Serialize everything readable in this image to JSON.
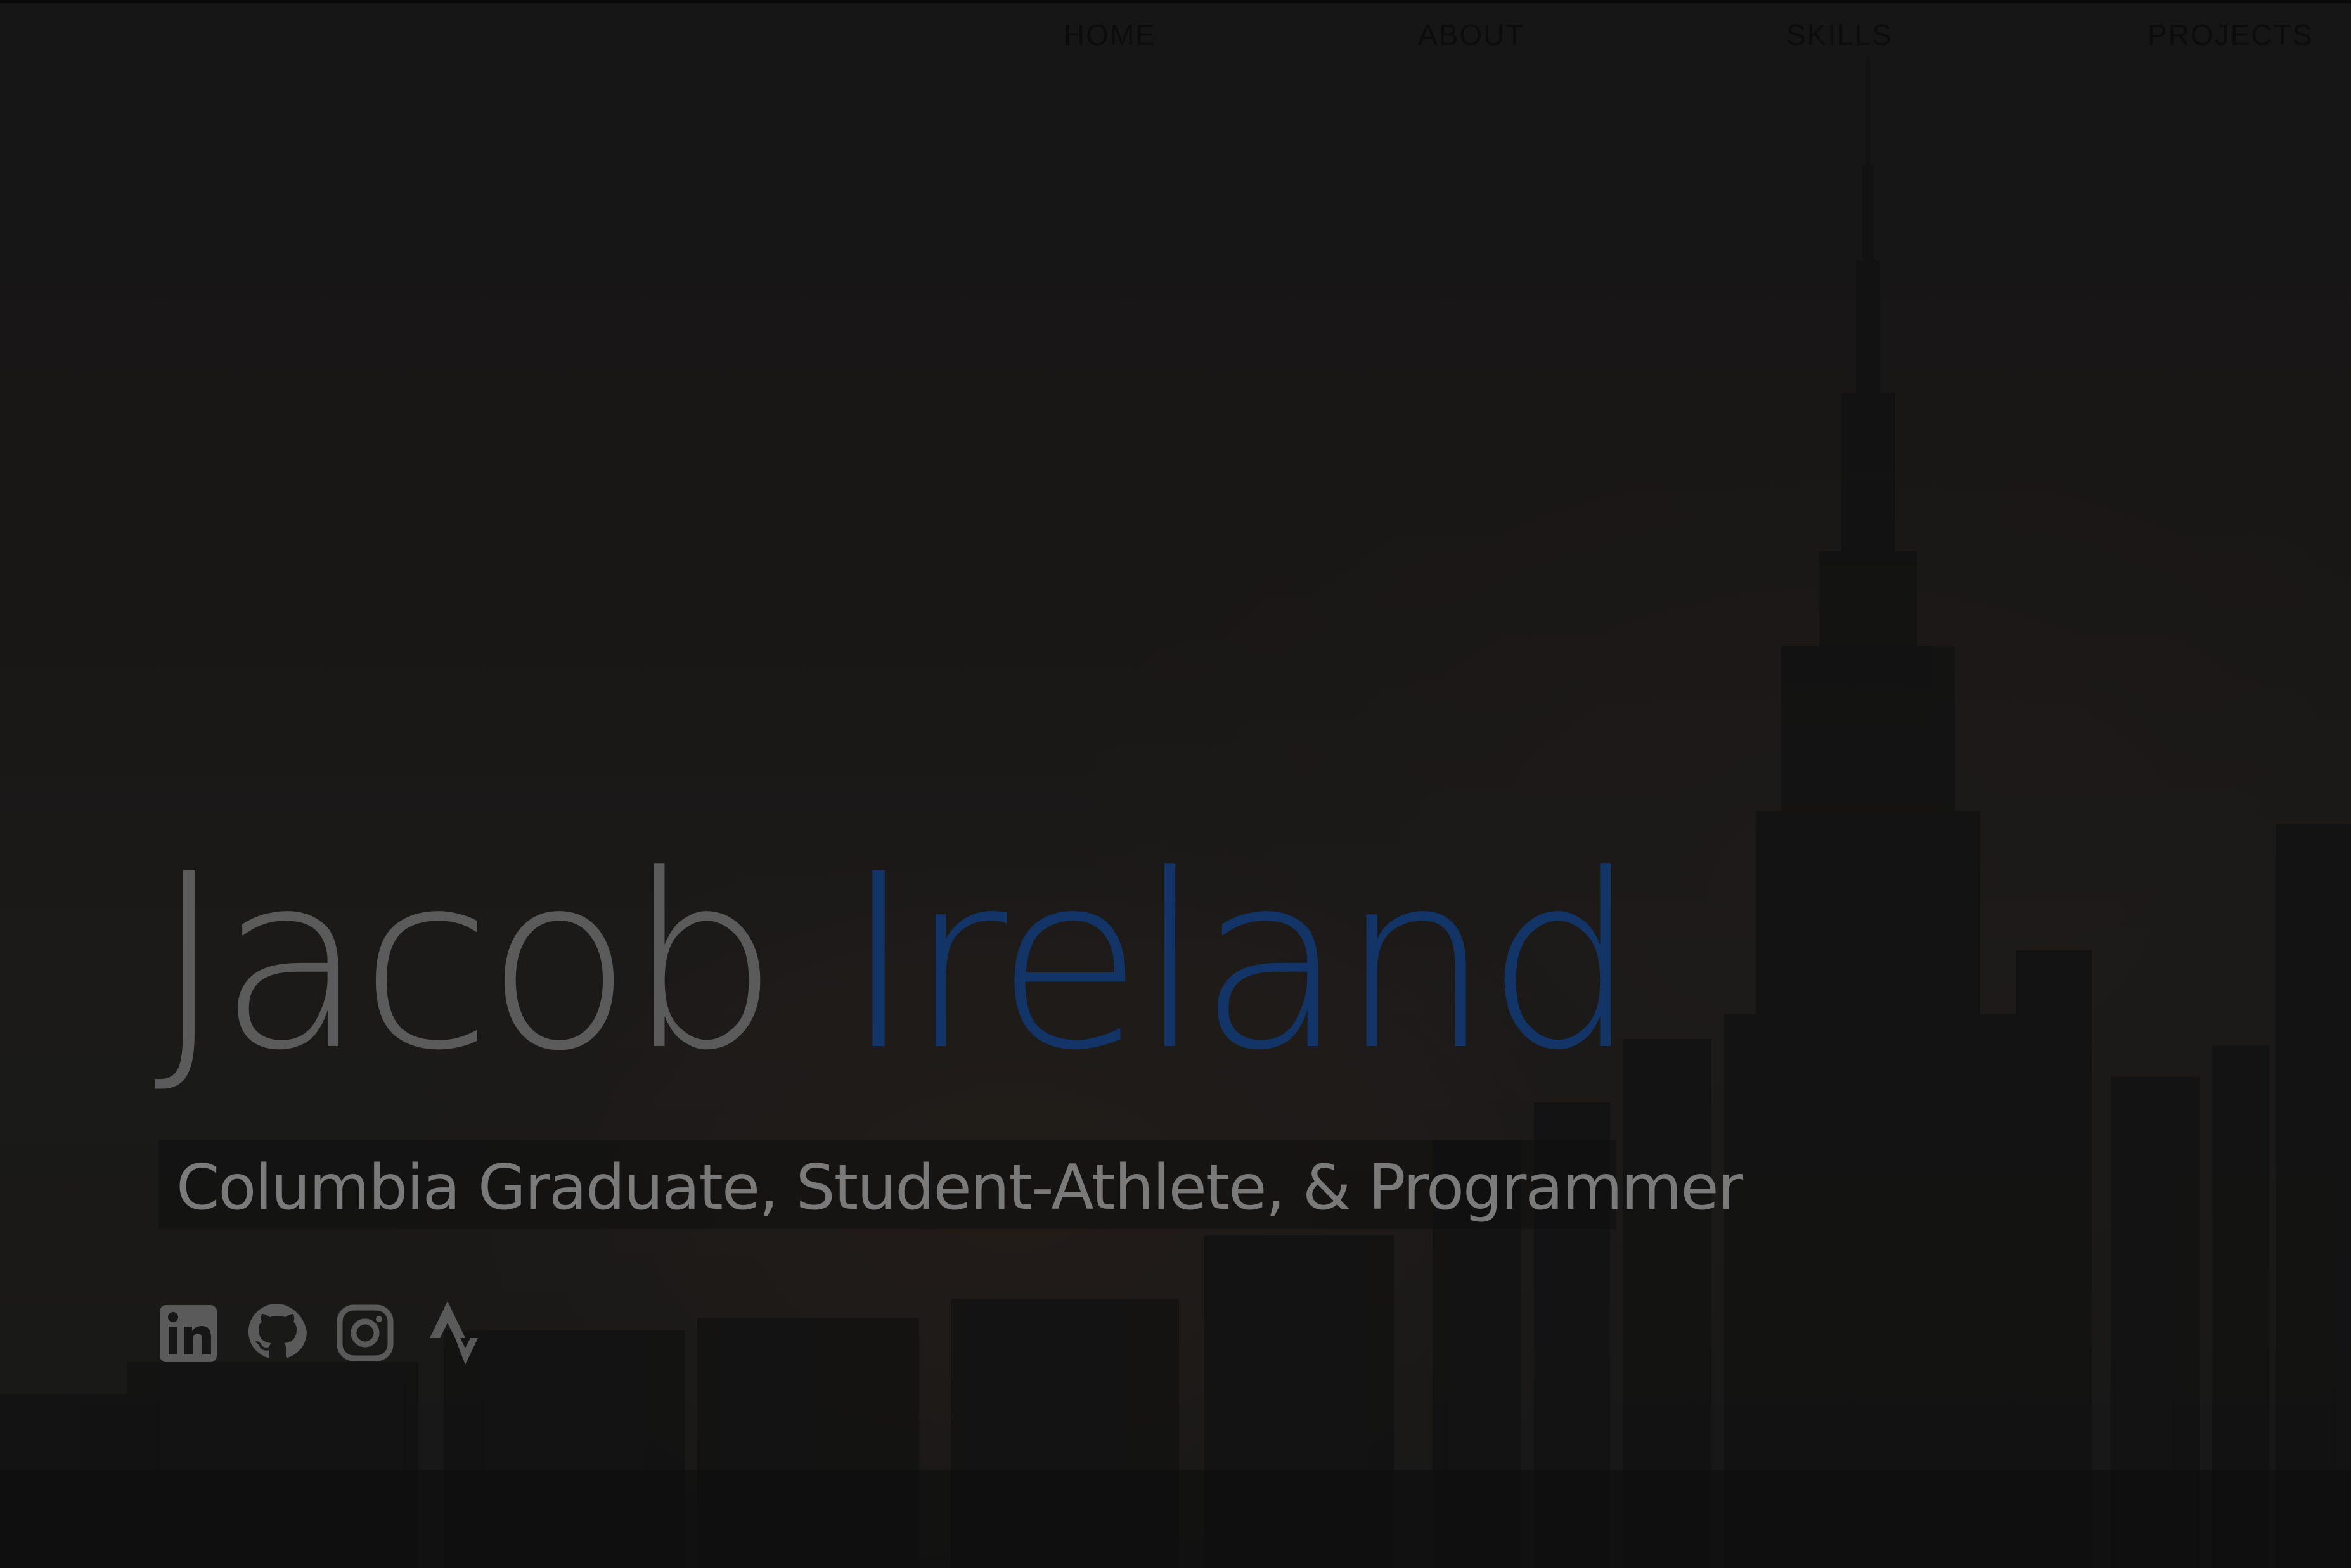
{
  "nav": {
    "items": [
      {
        "label": "HOME"
      },
      {
        "label": "ABOUT"
      },
      {
        "label": "SKILLS"
      },
      {
        "label": "PROJECTS"
      }
    ]
  },
  "hero": {
    "first_name": "Jacob",
    "last_name": "Ireland",
    "subtitle": "Columbia Graduate, Student-Athlete, & Programmer"
  },
  "social": [
    {
      "icon": "linkedin-icon"
    },
    {
      "icon": "github-icon"
    },
    {
      "icon": "instagram-icon"
    },
    {
      "icon": "strava-icon"
    }
  ],
  "colors": {
    "background": "#141414",
    "first_name": "#5b5b5b",
    "last_name": "#133466",
    "subtitle": "#7a7a7a",
    "nav_text": "#0c0c0c",
    "icon": "#5a5a5a"
  }
}
